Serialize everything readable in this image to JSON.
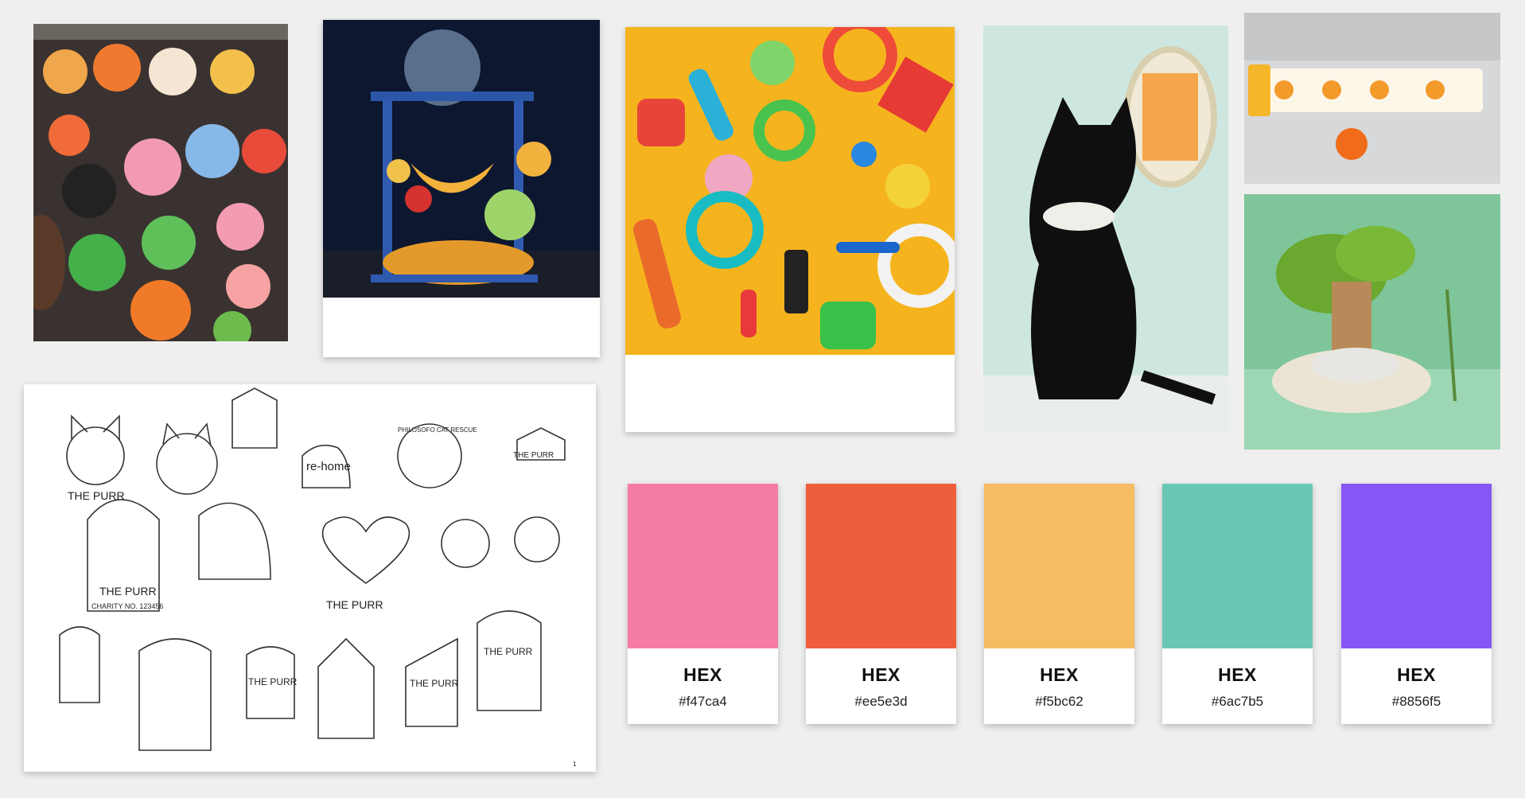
{
  "palette": [
    {
      "label": "HEX",
      "value": "#f47ca4",
      "color": "#f47ca4"
    },
    {
      "label": "HEX",
      "value": "#ee5e3d",
      "color": "#ee5e3d"
    },
    {
      "label": "HEX",
      "value": "#f5bc62",
      "color": "#f5bc62"
    },
    {
      "label": "HEX",
      "value": "#6ac7b5",
      "color": "#6ac7b5"
    },
    {
      "label": "HEX",
      "value": "#8856f5",
      "color": "#8856f5"
    }
  ],
  "sketch": {
    "brand_text": "THE PURR",
    "charity_text": "CHARITY NO. 123456",
    "rehome_text": "re-home",
    "rescue_text": "PHILOSOFO CAT RESCUE",
    "page_number": "1"
  },
  "images": [
    {
      "name": "ceramic-pet-toys-photo"
    },
    {
      "name": "space-cat-tree-photo"
    },
    {
      "name": "dog-toys-flatlay-photo"
    },
    {
      "name": "black-cat-photo"
    },
    {
      "name": "orange-collar-photo"
    },
    {
      "name": "bonsai-cat-bed-photo"
    }
  ]
}
